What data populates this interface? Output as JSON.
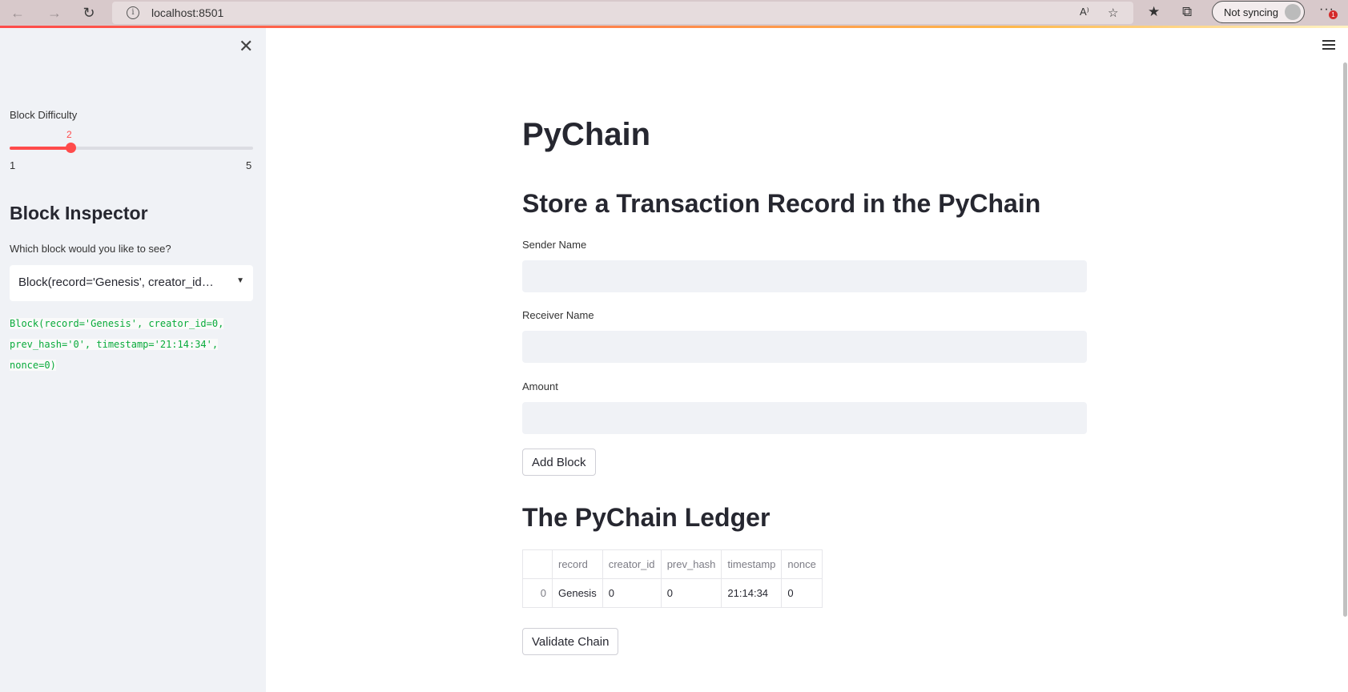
{
  "browser": {
    "url": "localhost:8501",
    "sync_label": "Not syncing",
    "notification_count": "1"
  },
  "sidebar": {
    "slider": {
      "label": "Block Difficulty",
      "value": "2",
      "value_num": 2,
      "min": "1",
      "max": "5",
      "min_num": 1,
      "max_num": 5,
      "accent_color": "#ff4b4b"
    },
    "inspector": {
      "heading": "Block Inspector",
      "question": "Which block would you like to see?",
      "selected": "Block(record='Genesis', creator_id=0, prev_hash='0', timestamp='21:14:34', nonce=0)",
      "code_lines": [
        "Block(record='Genesis', creator_id=0,",
        "prev_hash='0', timestamp='21:14:34',",
        "nonce=0)"
      ],
      "code_color": "#09ab3b"
    }
  },
  "main": {
    "title": "PyChain",
    "form_heading": "Store a Transaction Record in the PyChain",
    "sender": {
      "label": "Sender Name",
      "value": ""
    },
    "receiver": {
      "label": "Receiver Name",
      "value": ""
    },
    "amount": {
      "label": "Amount",
      "value": ""
    },
    "add_button": "Add Block",
    "ledger_heading": "The PyChain Ledger",
    "ledger": {
      "columns": [
        "",
        "record",
        "creator_id",
        "prev_hash",
        "timestamp",
        "nonce"
      ],
      "rows": [
        [
          "0",
          "Genesis",
          "0",
          "0",
          "21:14:34",
          "0"
        ]
      ]
    },
    "validate_button": "Validate Chain"
  }
}
